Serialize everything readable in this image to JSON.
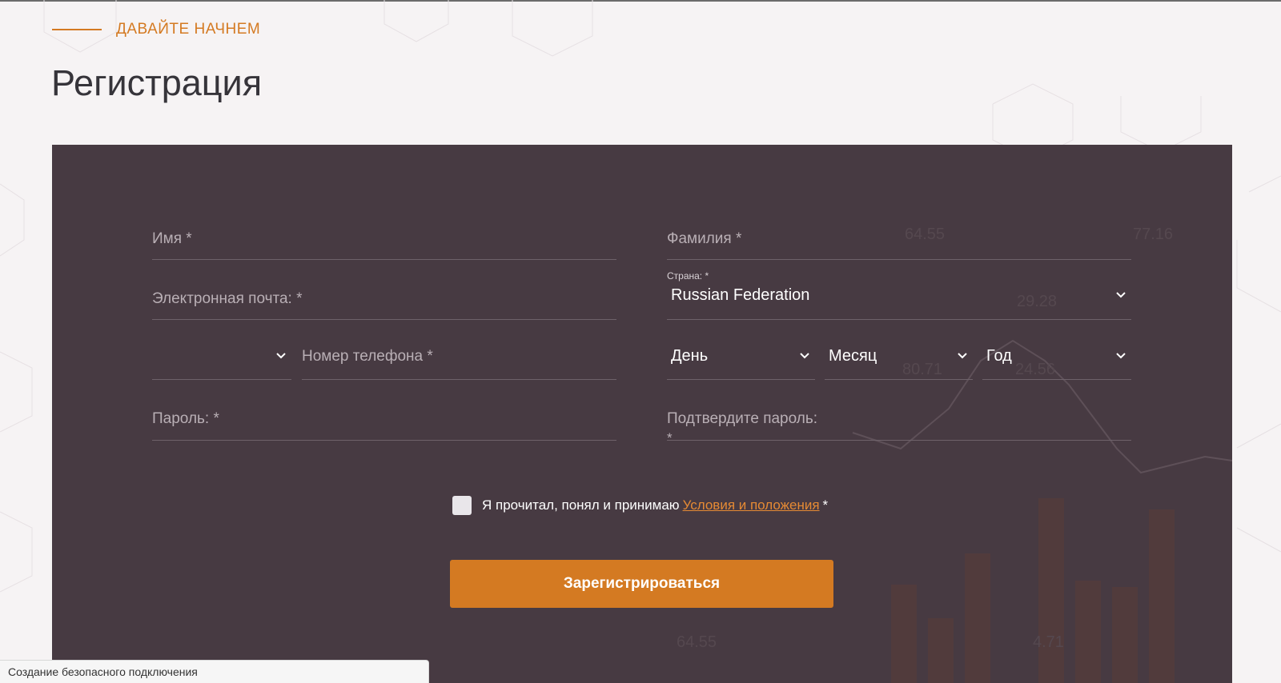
{
  "header": {
    "eyebrow": "ДАВАЙТЕ НАЧНЕМ",
    "title": "Регистрация"
  },
  "form": {
    "first_name": {
      "label": "Имя *",
      "value": ""
    },
    "last_name": {
      "label": "Фамилия *",
      "value": ""
    },
    "email": {
      "label": "Электронная почта: *",
      "value": ""
    },
    "country": {
      "label": "Страна: *",
      "value": "Russian Federation"
    },
    "phone_code": {
      "value": ""
    },
    "phone": {
      "label": "Номер телефона *",
      "value": ""
    },
    "birth_day": {
      "value": "День"
    },
    "birth_month": {
      "value": "Месяц"
    },
    "birth_year": {
      "value": "Год"
    },
    "password": {
      "label": "Пароль: *",
      "value": ""
    },
    "confirm_password": {
      "label_line1": "Подтвердите пароль:",
      "label_line2": "*",
      "value": ""
    },
    "consent": {
      "checked": false,
      "text": "Я прочитал, понял и принимаю",
      "link_text": "Условия и положения",
      "required_mark": "*"
    },
    "submit_label": "Зарегистрироваться"
  },
  "background_numbers": [
    "64.55",
    "77.16",
    "29.28",
    "80.71",
    "24.56",
    "64.55",
    "4.71"
  ],
  "status_bar": {
    "text": "Создание безопасного подключения"
  },
  "colors": {
    "accent": "#d47a22",
    "panel": "#473a42",
    "page_bg": "#f6f3f4",
    "link": "#e58a34"
  },
  "icons": {
    "chevron": "chevron-down-icon"
  }
}
